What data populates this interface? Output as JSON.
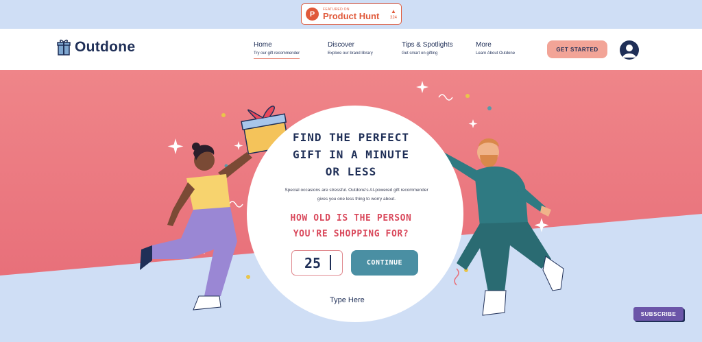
{
  "product_hunt": {
    "featured": "FEATURED ON",
    "name": "Product Hunt",
    "count": "324"
  },
  "brand": {
    "name": "Outdone",
    "icon": "gift-icon"
  },
  "nav": [
    {
      "title": "Home",
      "subtitle": "Try our gift recommender",
      "active": true
    },
    {
      "title": "Discover",
      "subtitle": "Explore our brand library"
    },
    {
      "title": "Tips & Spotlights",
      "subtitle": "Get smart on gifting"
    },
    {
      "title": "More",
      "subtitle": "Learn About Outdone"
    }
  ],
  "header": {
    "cta_label": "GET STARTED"
  },
  "hero": {
    "headline_lines": [
      "FIND THE PERFECT",
      "GIFT IN A MINUTE",
      "OR LESS"
    ],
    "description_lines": [
      "Special occasions are stressful. Outdone's AI-powered gift recommender",
      "gives you one less thing to worry about."
    ],
    "question_lines": [
      "HOW OLD IS THE PERSON",
      "YOU'RE SHOPPING FOR?"
    ],
    "age_value": "25",
    "continue_label": "CONTINUE",
    "hint": "Type Here"
  },
  "subscribe_label": "SUBSCRIBE",
  "colors": {
    "navy": "#1f2f57",
    "coral": "#f2a497",
    "red": "#d9485b",
    "teal": "#4a8fa3",
    "hero_pink": "#ec7f86",
    "sky": "#cfdef5"
  }
}
